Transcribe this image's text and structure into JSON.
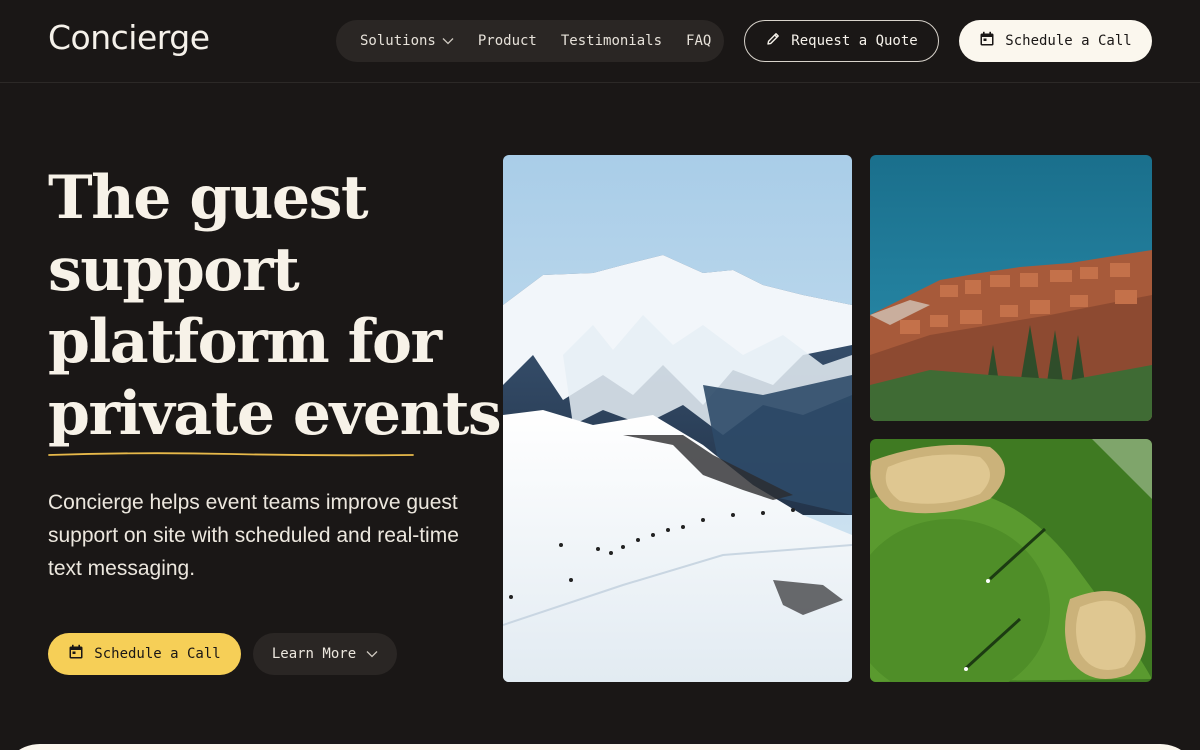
{
  "header": {
    "logo": "Concierge",
    "nav": [
      {
        "label": "Solutions",
        "has_dropdown": true
      },
      {
        "label": "Product"
      },
      {
        "label": "Testimonials"
      },
      {
        "label": "FAQ"
      }
    ],
    "quote_button": "Request a Quote",
    "call_button": "Schedule a Call"
  },
  "hero": {
    "headline_lines": [
      "The guest",
      "support",
      "platform for",
      "private events"
    ],
    "subtext": "Concierge helps event teams improve guest support on site with scheduled and real-time text messaging.",
    "primary_cta": "Schedule a Call",
    "secondary_cta": "Learn More"
  },
  "icons": {
    "nav_dropdown": "chevron-down-icon",
    "quote": "pencil-icon",
    "call": "calendar-icon",
    "learn_more": "chevron-down-icon"
  },
  "colors": {
    "background": "#1a1716",
    "accent_yellow": "#f6cf57",
    "light_button": "#fbf7ee",
    "nav_pill": "#2a2624"
  }
}
